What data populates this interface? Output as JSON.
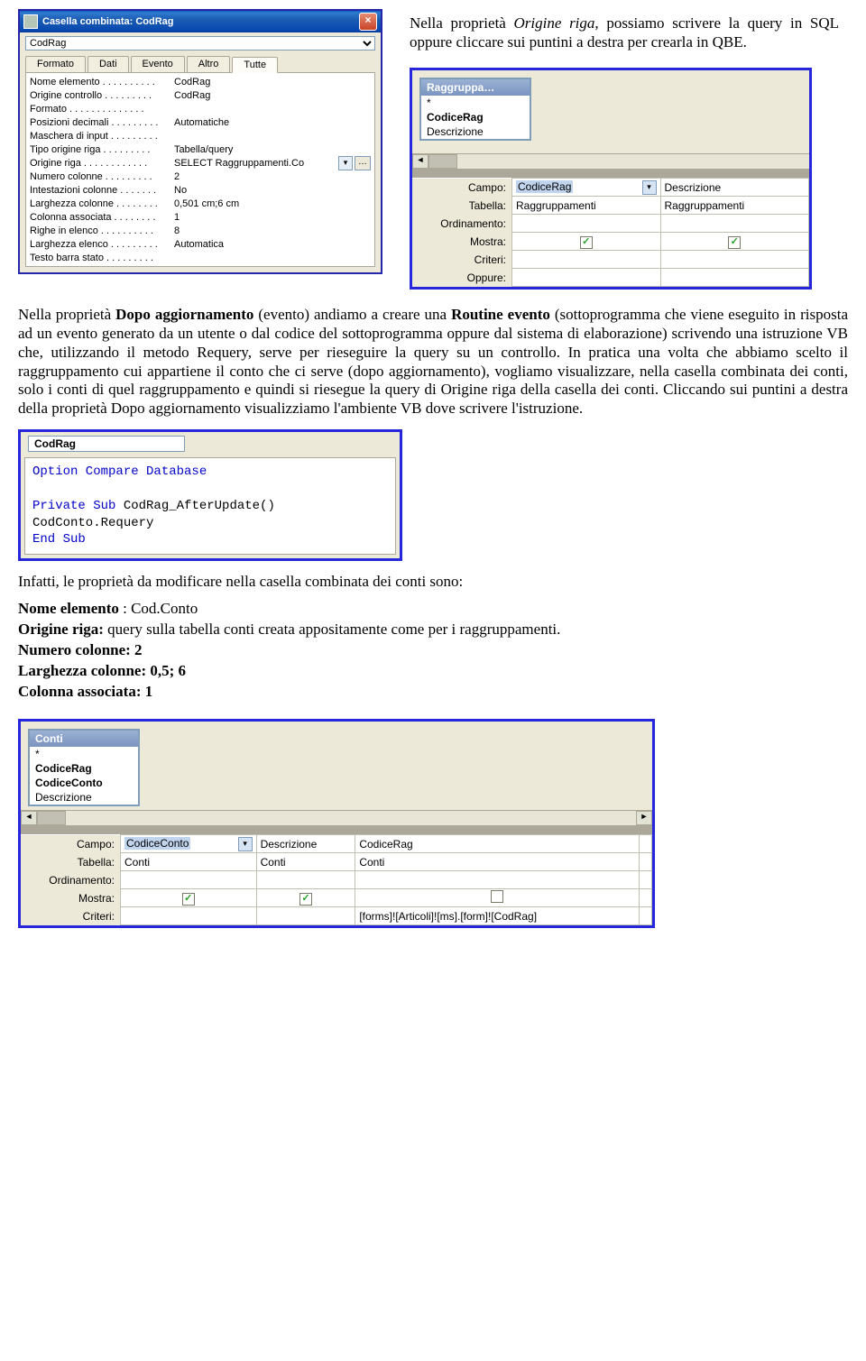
{
  "para_intro": {
    "pre": "Nella proprietà ",
    "italic": "Origine riga",
    "post": ", possiamo scrivere la query in SQL oppure cliccare sui puntini a destra per crearla in QBE."
  },
  "prop_window": {
    "title": "Casella combinata: CodRag",
    "combo_value": "CodRag",
    "tabs": [
      "Formato",
      "Dati",
      "Evento",
      "Altro",
      "Tutte"
    ],
    "active_tab": 4,
    "rows": [
      {
        "k": "Nome elemento . . . . . . . . . .",
        "v": "CodRag"
      },
      {
        "k": "Origine controllo . . . . . . . . .",
        "v": "CodRag"
      },
      {
        "k": "Formato . . . . . . . . . . . . . .",
        "v": ""
      },
      {
        "k": "Posizioni decimali . . . . . . . . .",
        "v": "Automatiche"
      },
      {
        "k": "Maschera di input . . . . . . . . .",
        "v": ""
      },
      {
        "k": "Tipo origine riga . . . . . . . . .",
        "v": "Tabella/query"
      },
      {
        "k": "Origine riga . . . . . . . . . . . .",
        "v": "SELECT Raggruppamenti.Co",
        "dd": true,
        "btn": true
      },
      {
        "k": "Numero colonne . . . . . . . . .",
        "v": "2"
      },
      {
        "k": "Intestazioni colonne . . . . . . .",
        "v": "No"
      },
      {
        "k": "Larghezza colonne . . . . . . . .",
        "v": "0,501 cm;6 cm"
      },
      {
        "k": "Colonna associata . . . . . . . .",
        "v": "1"
      },
      {
        "k": "Righe in elenco . . . . . . . . . .",
        "v": "8"
      },
      {
        "k": "Larghezza elenco . . . . . . . . .",
        "v": "Automatica"
      },
      {
        "k": "Testo barra stato . . . . . . . . .",
        "v": ""
      }
    ]
  },
  "qbe1": {
    "table_name": "Raggruppa…",
    "fields": [
      "*",
      "CodiceRag",
      "Descrizione"
    ],
    "grid_labels": [
      "Campo:",
      "Tabella:",
      "Ordinamento:",
      "Mostra:",
      "Criteri:",
      "Oppure:"
    ],
    "cols": [
      {
        "campo": "CodiceRag",
        "tabella": "Raggruppamenti",
        "mostra": true,
        "sel": true,
        "criteri": ""
      },
      {
        "campo": "Descrizione",
        "tabella": "Raggruppamenti",
        "mostra": true,
        "criteri": ""
      }
    ]
  },
  "para_main": {
    "t1": "Nella    proprietà ",
    "b1": "Dopo aggiornamento",
    "t2": " (evento) andiamo a creare una ",
    "b2": "Routine evento",
    "t3": " (sottoprogramma che viene eseguito in risposta ad un evento generato da un utente o dal codice del sottoprogramma oppure dal sistema di elaborazione) scrivendo una istruzione VB che, utilizzando il metodo Requery, serve per rieseguire la query su un controllo. In pratica una volta che abbiamo scelto il raggruppamento cui appartiene il conto che ci serve (dopo aggiornamento), vogliamo visualizzare, nella casella combinata dei conti, solo i conti di quel raggruppamento e quindi si riesegue la query di Origine riga della casella dei conti. Cliccando sui puntini a destra della proprietà Dopo aggiornamento visualizziamo l'ambiente VB dove scrivere l'istruzione."
  },
  "code_box": {
    "object": "CodRag",
    "line1": "Option Compare Database",
    "line2a": "Private Sub ",
    "line2b": "CodRag_AfterUpdate()",
    "line3": "CodConto.Requery",
    "line4": "End Sub"
  },
  "para_after_code": "Infatti, le proprietà da modificare nella casella combinata dei conti sono:",
  "props_list": {
    "l1a": "Nome elemento",
    "l1b": " : Cod.Conto",
    "l2a": "Origine riga:",
    "l2b": " query sulla tabella conti creata appositamente come per i raggruppamenti.",
    "l3": "Numero colonne: 2",
    "l4": "Larghezza colonne: 0,5; 6",
    "l5": "Colonna associata: 1"
  },
  "qbe2": {
    "table_name": "Conti",
    "fields": [
      "*",
      "CodiceRag",
      "CodiceConto",
      "Descrizione"
    ],
    "grid_labels": [
      "Campo:",
      "Tabella:",
      "Ordinamento:",
      "Mostra:",
      "Criteri:"
    ],
    "cols": [
      {
        "campo": "CodiceConto",
        "tabella": "Conti",
        "mostra": true,
        "sel": true,
        "criteri": ""
      },
      {
        "campo": "Descrizione",
        "tabella": "Conti",
        "mostra": true,
        "criteri": ""
      },
      {
        "campo": "CodiceRag",
        "tabella": "Conti",
        "mostra": false,
        "criteri": "[forms]![Articoli]![ms].[form]![CodRag]"
      }
    ]
  }
}
